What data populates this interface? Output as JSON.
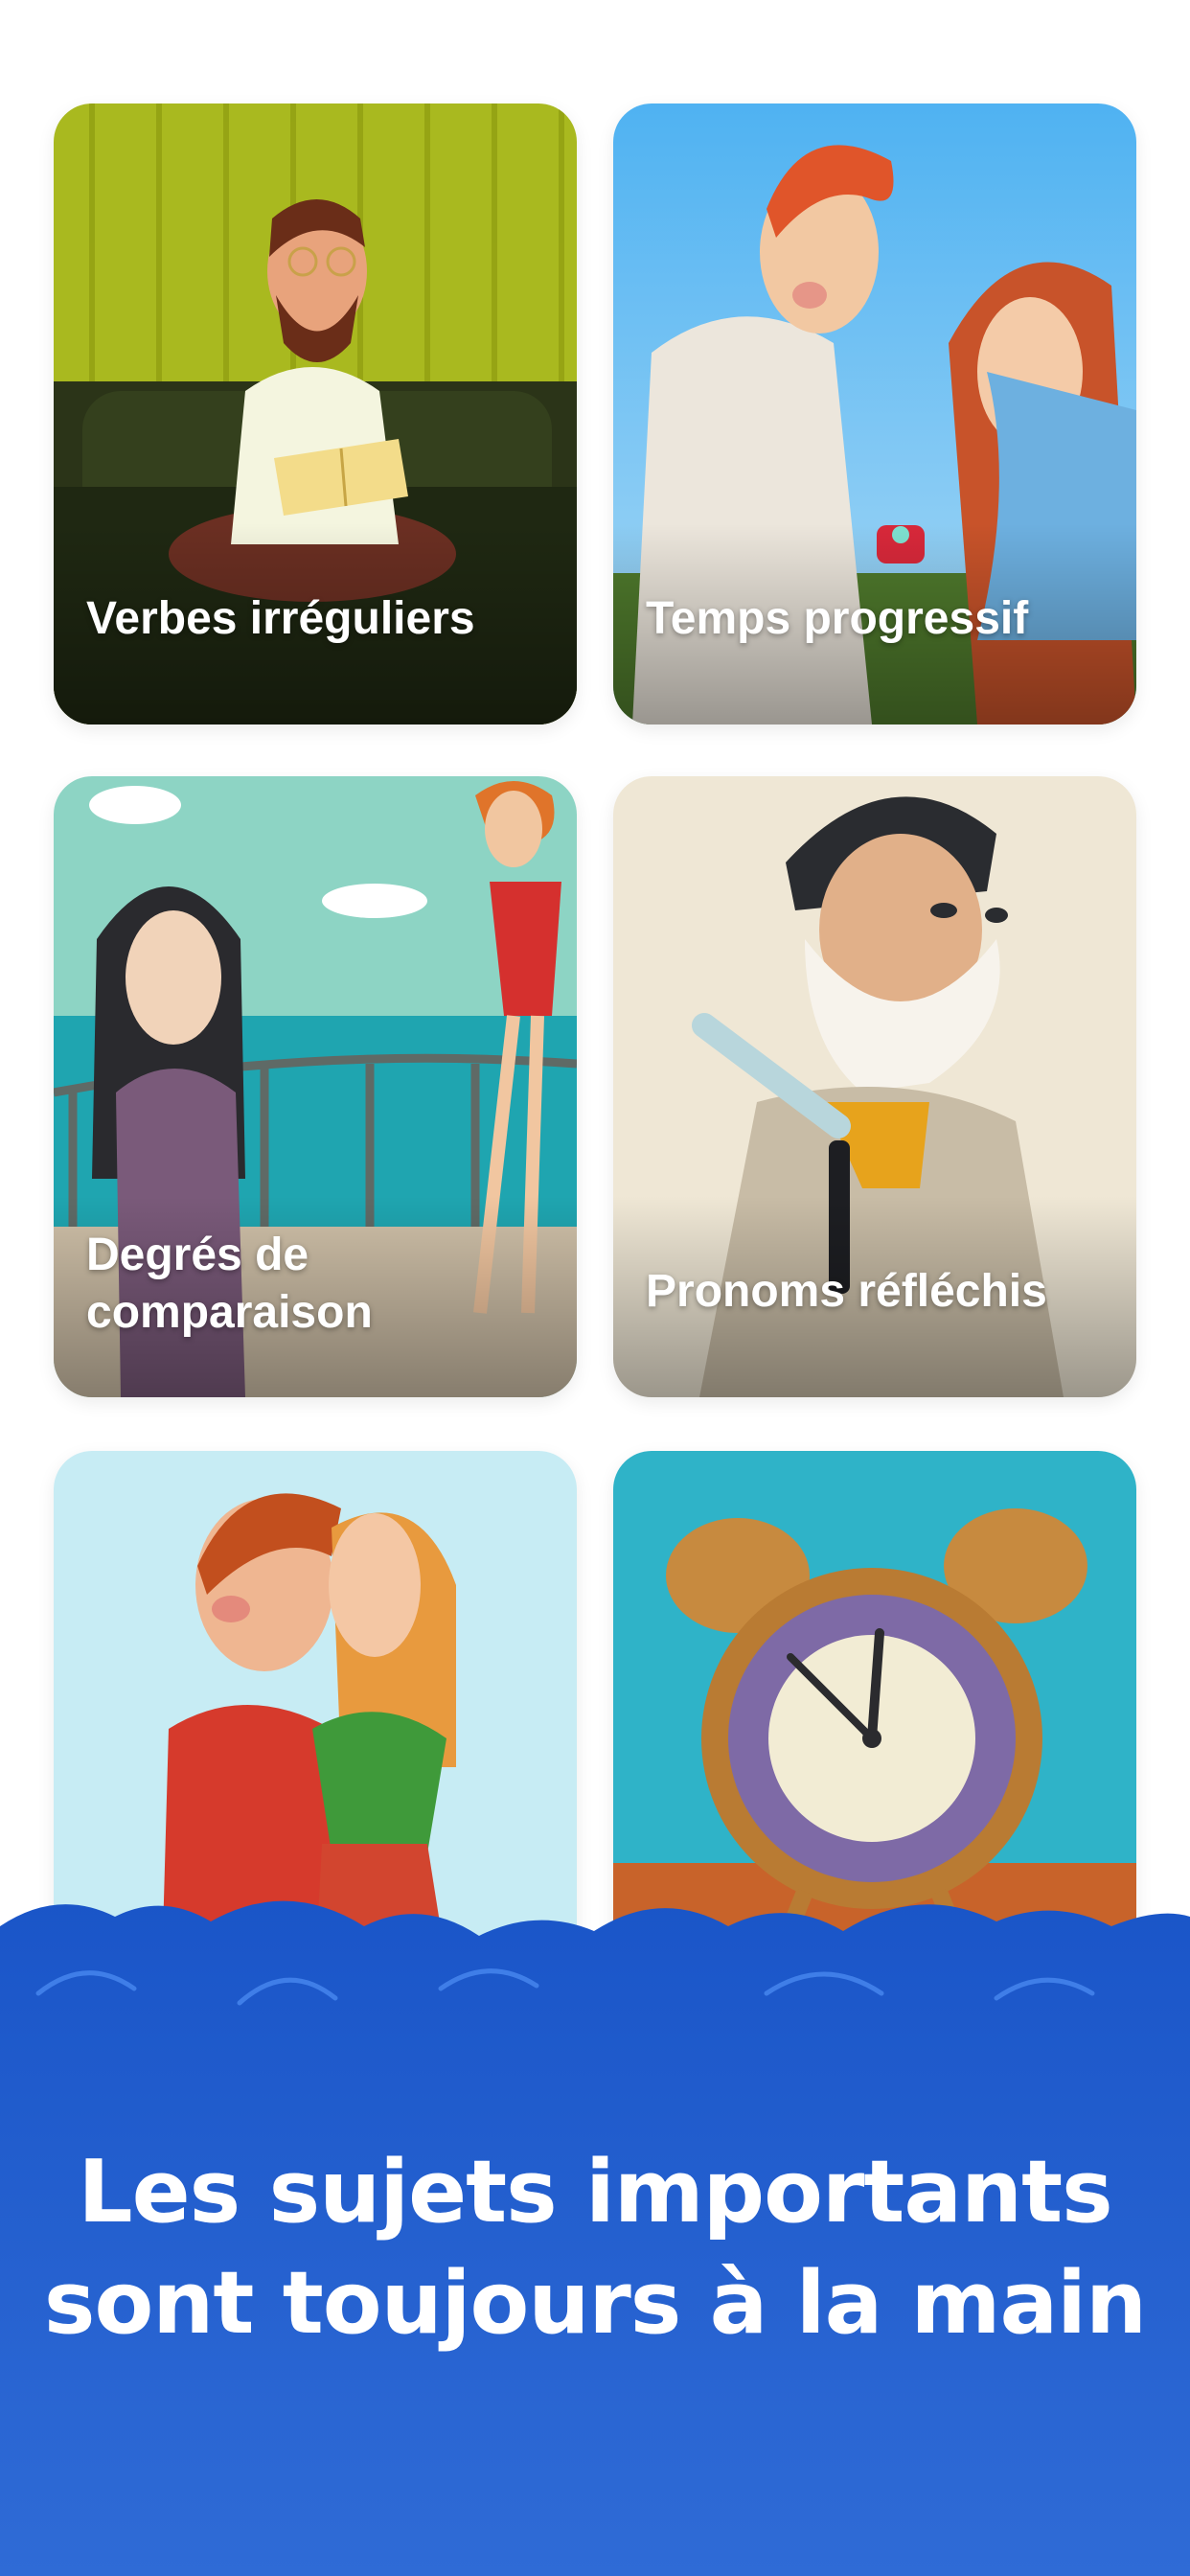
{
  "cards": [
    {
      "title": "Verbes irréguliers",
      "illustration": "man-reading-book-on-sofa"
    },
    {
      "title": "Temps progressif",
      "illustration": "man-proposing-with-ring"
    },
    {
      "title": "Degrés de\ncomparaison",
      "illustration": "women-on-ship-deck"
    },
    {
      "title": "Pronoms réfléchis",
      "illustration": "man-shaving-with-razor"
    },
    {
      "title": "",
      "illustration": "couple-kissing"
    },
    {
      "title": "",
      "illustration": "alarm-clock"
    }
  ],
  "banner": {
    "headline": "Les sujets importants\nsont toujours à la main"
  },
  "colors": {
    "banner_top": "#1a55c8",
    "banner_bottom": "#2f6bd6",
    "cloud_outline": "#3f7ee8",
    "label_text": "#ffffff"
  }
}
